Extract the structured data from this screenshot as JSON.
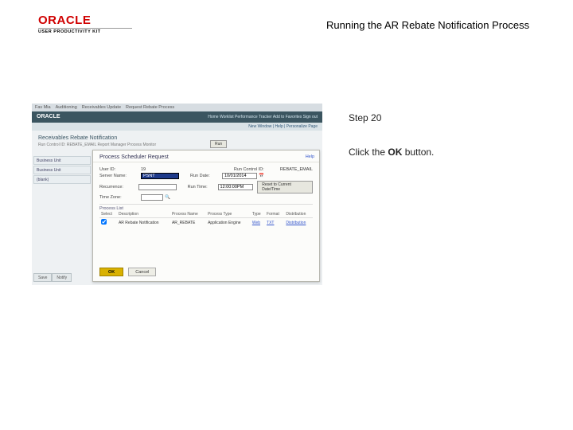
{
  "header": {
    "brand_word": "ORACLE",
    "upk": "USER PRODUCTIVITY KIT",
    "page_title": "Running the AR Rebate Notification Process"
  },
  "instructions": {
    "step_label": "Step 20",
    "line1": "Click the ",
    "bold": "OK",
    "line2": " button."
  },
  "shot": {
    "tabs": [
      "Fav Mia",
      "Auditioning",
      "Receivables Update",
      "Request Rebate Process"
    ],
    "oracle_links_left": "Home     Worklist     Performance Tracker     Add to Favorites     Sign out",
    "subbar": "New Window | Help | Personalize Page",
    "page_heading": "Receivables Rebate Notification",
    "crumb": "Run Control ID: REBATE_EMAIL   Report Manager   Process Monitor",
    "run_label": "Run",
    "dialog": {
      "title": "Process Scheduler Request",
      "help": "Help",
      "user_id_label": "User ID:",
      "user_id_val": "19",
      "run_ctrl_label": "Run Control ID:",
      "run_ctrl_val": "REBATE_EMAIL",
      "server_label": "Server Name:",
      "server_val": "PSNT",
      "rundate_label": "Run Date:",
      "rundate_val": "10/01/2014",
      "recur_label": "Recurrence:",
      "recur_val": "",
      "runtime_label": "Run Time:",
      "runtime_val": "12:00:00PM",
      "tz_label": "Time Zone:",
      "tz_val": "",
      "reset_btn": "Reset to Current Date/Time",
      "plist_header": "Process List",
      "cols": {
        "sel": "Select",
        "desc": "Description",
        "pname": "Process Name",
        "ptype": "Process Type",
        "type": "Type",
        "fmt": "Format",
        "dist": "Distribution"
      },
      "row": {
        "desc": "AR Rebate Notification",
        "pname": "AR_REBATE",
        "ptype": "Application Engine",
        "type": "Web",
        "fmt": "TXT",
        "dist": "Distribution"
      },
      "ok": "OK",
      "cancel": "Cancel"
    },
    "left": {
      "a": "Business Unit",
      "b": "Business Unit",
      "c": "(blank)"
    },
    "bottom_tabs": {
      "a": "Save",
      "b": "Notify"
    }
  }
}
